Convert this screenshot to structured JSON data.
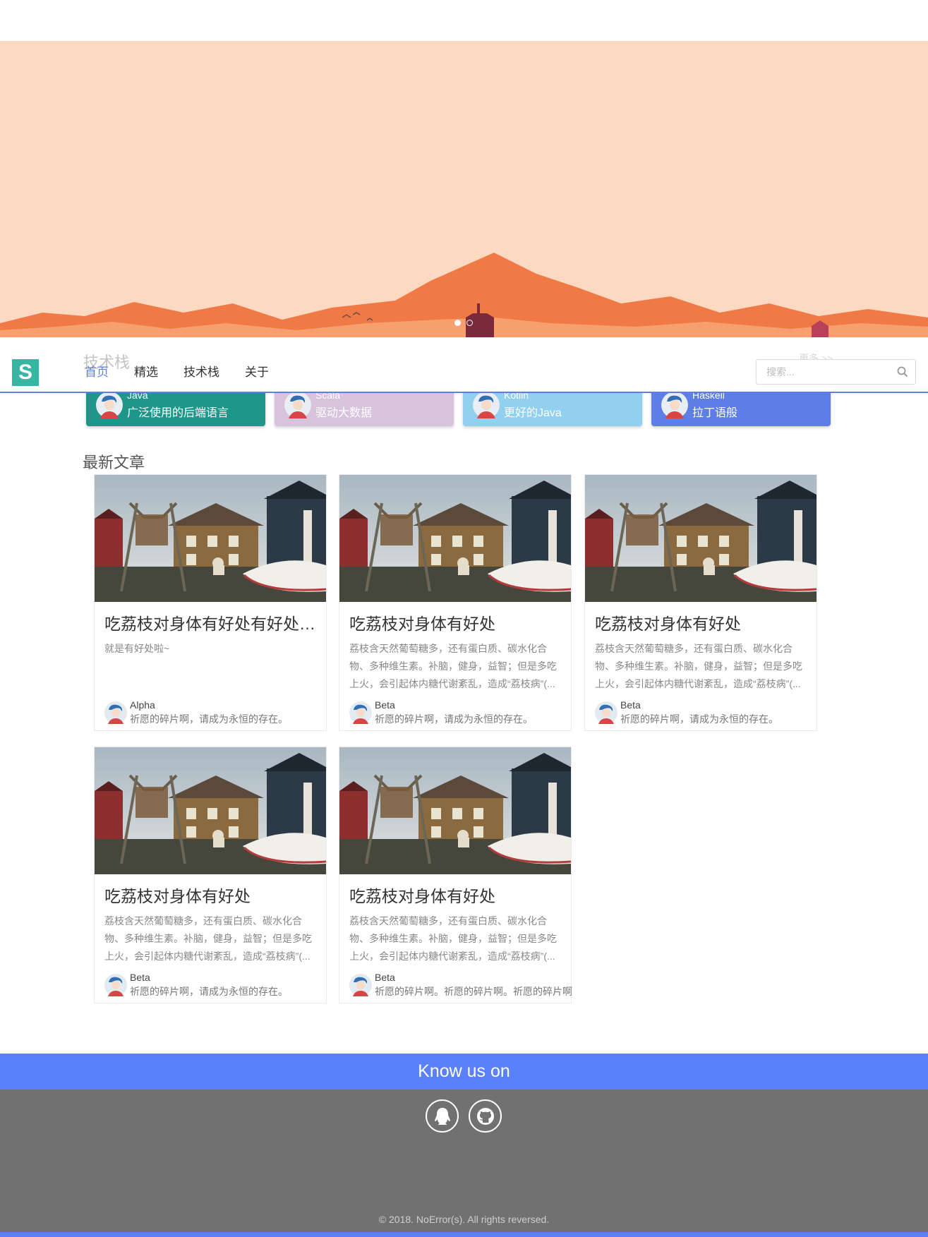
{
  "brand": {
    "logo_letter": "S",
    "color": "#38b5a3"
  },
  "nav": {
    "items": [
      {
        "label": "首页",
        "active": true
      },
      {
        "label": "精选",
        "active": false
      },
      {
        "label": "技术栈",
        "active": false
      },
      {
        "label": "关于",
        "active": false
      }
    ],
    "accent": "#5c7ee6"
  },
  "search": {
    "placeholder": "搜索...",
    "icon": "search-icon"
  },
  "hero": {
    "slides": 2,
    "active_slide": 1,
    "background": "#fdd9c1"
  },
  "tech_stack": {
    "title": "技术栈",
    "more": "更多 >>",
    "items": [
      {
        "name": "Java",
        "desc": "广泛使用的后端语言",
        "color": "#1f968a"
      },
      {
        "name": "Scala",
        "desc": "驱动大数据",
        "color": "#d7c3dc"
      },
      {
        "name": "Kotlin",
        "desc": "更好的Java",
        "color": "#91d0ee"
      },
      {
        "name": "Haskell",
        "desc": "拉丁语般",
        "color": "#5c7ee6"
      }
    ]
  },
  "latest": {
    "title": "最新文章",
    "articles": [
      {
        "title": "吃荔枝对身体有好处有好处有好处",
        "excerpt": "就是有好处啦~",
        "author": "Alpha",
        "bio": "祈愿的碎片啊，请成为永恒的存在。"
      },
      {
        "title": "吃荔枝对身体有好处",
        "excerpt": "荔枝含天然葡萄糖多，还有蛋白质、碳水化合物、多种维生素。补脑，健身，益智；但是多吃上火，会引起体内糖代谢紊乱，造成“荔枝病”(...",
        "author": "Beta",
        "bio": "祈愿的碎片啊，请成为永恒的存在。"
      },
      {
        "title": "吃荔枝对身体有好处",
        "excerpt": "荔枝含天然葡萄糖多，还有蛋白质、碳水化合物、多种维生素。补脑，健身，益智；但是多吃上火，会引起体内糖代谢紊乱，造成“荔枝病”(...",
        "author": "Beta",
        "bio": "祈愿的碎片啊，请成为永恒的存在。"
      },
      {
        "title": "吃荔枝对身体有好处",
        "excerpt": "荔枝含天然葡萄糖多，还有蛋白质、碳水化合物、多种维生素。补脑，健身，益智；但是多吃上火，会引起体内糖代谢紊乱，造成“荔枝病”(...",
        "author": "Beta",
        "bio": "祈愿的碎片啊，请成为永恒的存在。"
      },
      {
        "title": "吃荔枝对身体有好处",
        "excerpt": "荔枝含天然葡萄糖多，还有蛋白质、碳水化合物、多种维生素。补脑，健身，益智；但是多吃上火，会引起体内糖代谢紊乱，造成“荔枝病”(...",
        "author": "Beta",
        "bio": "祈愿的碎片啊。祈愿的碎片啊。祈愿的碎片啊"
      }
    ]
  },
  "footer": {
    "heading": "Know us on",
    "social": [
      {
        "icon": "qq-icon"
      },
      {
        "icon": "github-icon"
      }
    ],
    "copyright": "© 2018. NoError(s). All rights reversed.",
    "band_color": "#5a80fb",
    "bg_color": "#717171"
  }
}
